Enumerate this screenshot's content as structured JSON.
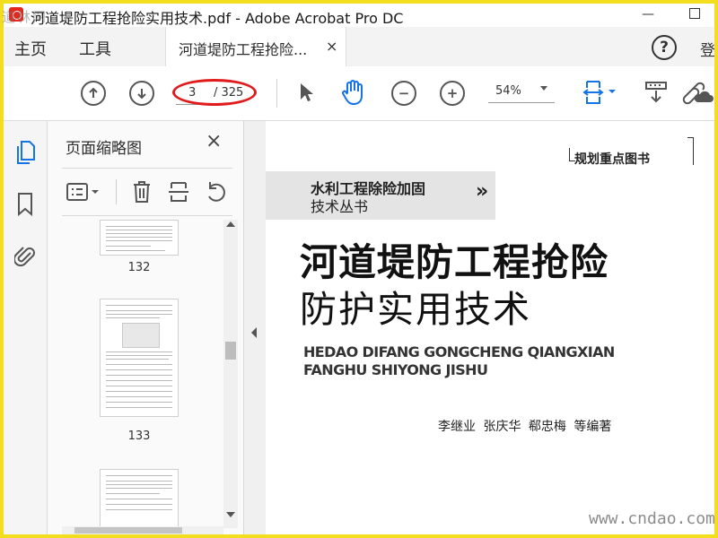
{
  "window": {
    "title": "河道堤防工程抢险实用技术.pdf - Adobe Acrobat Pro DC",
    "minimize": "—",
    "close": "×"
  },
  "menu": {
    "home": "主页",
    "tools": "工具",
    "doc_tab": "河道堤防工程抢险...",
    "doc_tab_close": "×",
    "help": "?",
    "signin_fragment": "登"
  },
  "toolbar": {
    "page_current": "3",
    "page_total": "/ 325",
    "zoom": "54%",
    "zoom_out": "−",
    "zoom_in": "+"
  },
  "thumbnails_panel": {
    "title": "页面缩略图",
    "close": "×",
    "pages": [
      {
        "label": "132"
      },
      {
        "label": "133"
      }
    ]
  },
  "document": {
    "series_badge": "规划重点图书",
    "series_line1": "水利工程除险加固",
    "series_line2": "技术丛书",
    "chevrons": "»",
    "title_line1": "河道堤防工程抢险",
    "title_line2": "防护实用技术",
    "pinyin_line1": "HEDAO DIFANG GONGCHENG QIANGXIAN",
    "pinyin_line2": "FANGHU SHIYONG JISHU",
    "authors": "李继业 张庆华 郗忠梅 等编著"
  },
  "watermarks": {
    "top_left": "道林网",
    "bottom_right": "www.cndao.com"
  },
  "colors": {
    "frame": "#f2dd1f",
    "annotation_ring": "#e01b1b",
    "accent_blue": "#1473e6",
    "app_red": "#e3271c"
  }
}
